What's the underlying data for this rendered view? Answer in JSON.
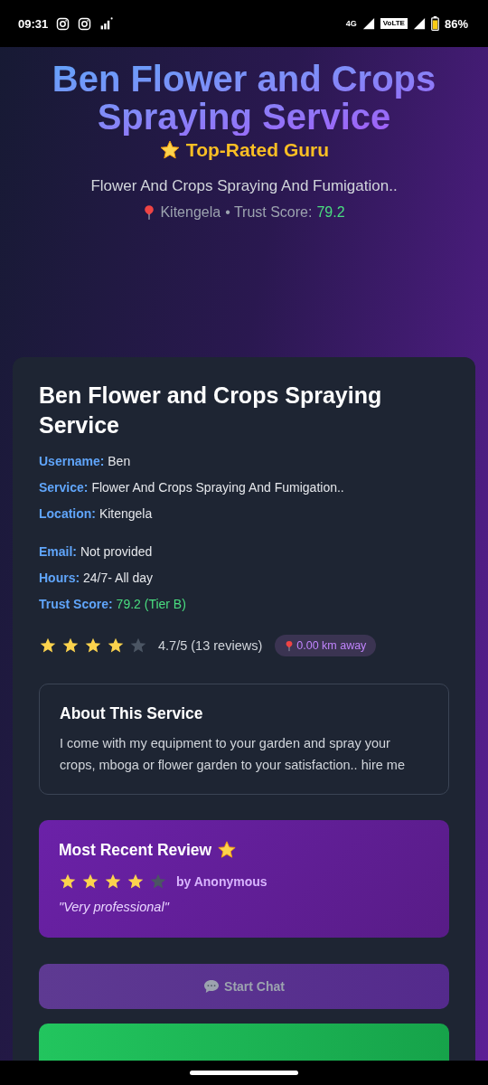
{
  "status_bar": {
    "time": "09:31",
    "network": "4G",
    "volte": "VoLTE",
    "battery": "86%"
  },
  "hero": {
    "title": "Ben Flower and Crops Spraying Service",
    "badge": "Top-Rated Guru",
    "subtitle": "Flower And Crops Spraying And Fumigation..",
    "location": "Kitengela",
    "score_label": "• Trust Score:",
    "score": "79.2"
  },
  "card": {
    "title": "Ben Flower and Crops Spraying Service",
    "field_groups": [
      [
        {
          "label": "Username:",
          "value": "Ben",
          "kind": "text"
        },
        {
          "label": "Service:",
          "value": "Flower And Crops Spraying And Fumigation..",
          "kind": "text"
        },
        {
          "label": "Location:",
          "value": "Kitengela",
          "kind": "text"
        }
      ],
      [
        {
          "label": "Email:",
          "value": "Not provided",
          "kind": "text"
        },
        {
          "label": "Hours:",
          "value": "24/7- All day",
          "kind": "text"
        },
        {
          "label": "Trust Score:",
          "value": "79.2 (Tier B)",
          "kind": "score"
        }
      ]
    ],
    "rating": {
      "stars": 4,
      "text": "4.7/5 (13 reviews)",
      "distance": "0.00 km away"
    },
    "about": {
      "title": "About This Service",
      "text": "I come with my equipment to your garden and spray your crops, mboga or flower garden to your satisfaction.. hire me"
    },
    "review": {
      "title": "Most Recent Review",
      "stars": 4,
      "author": "by Anonymous",
      "quote": "\"Very professional\""
    },
    "chat_button": {
      "label": "Start Chat",
      "disabled": true
    }
  }
}
